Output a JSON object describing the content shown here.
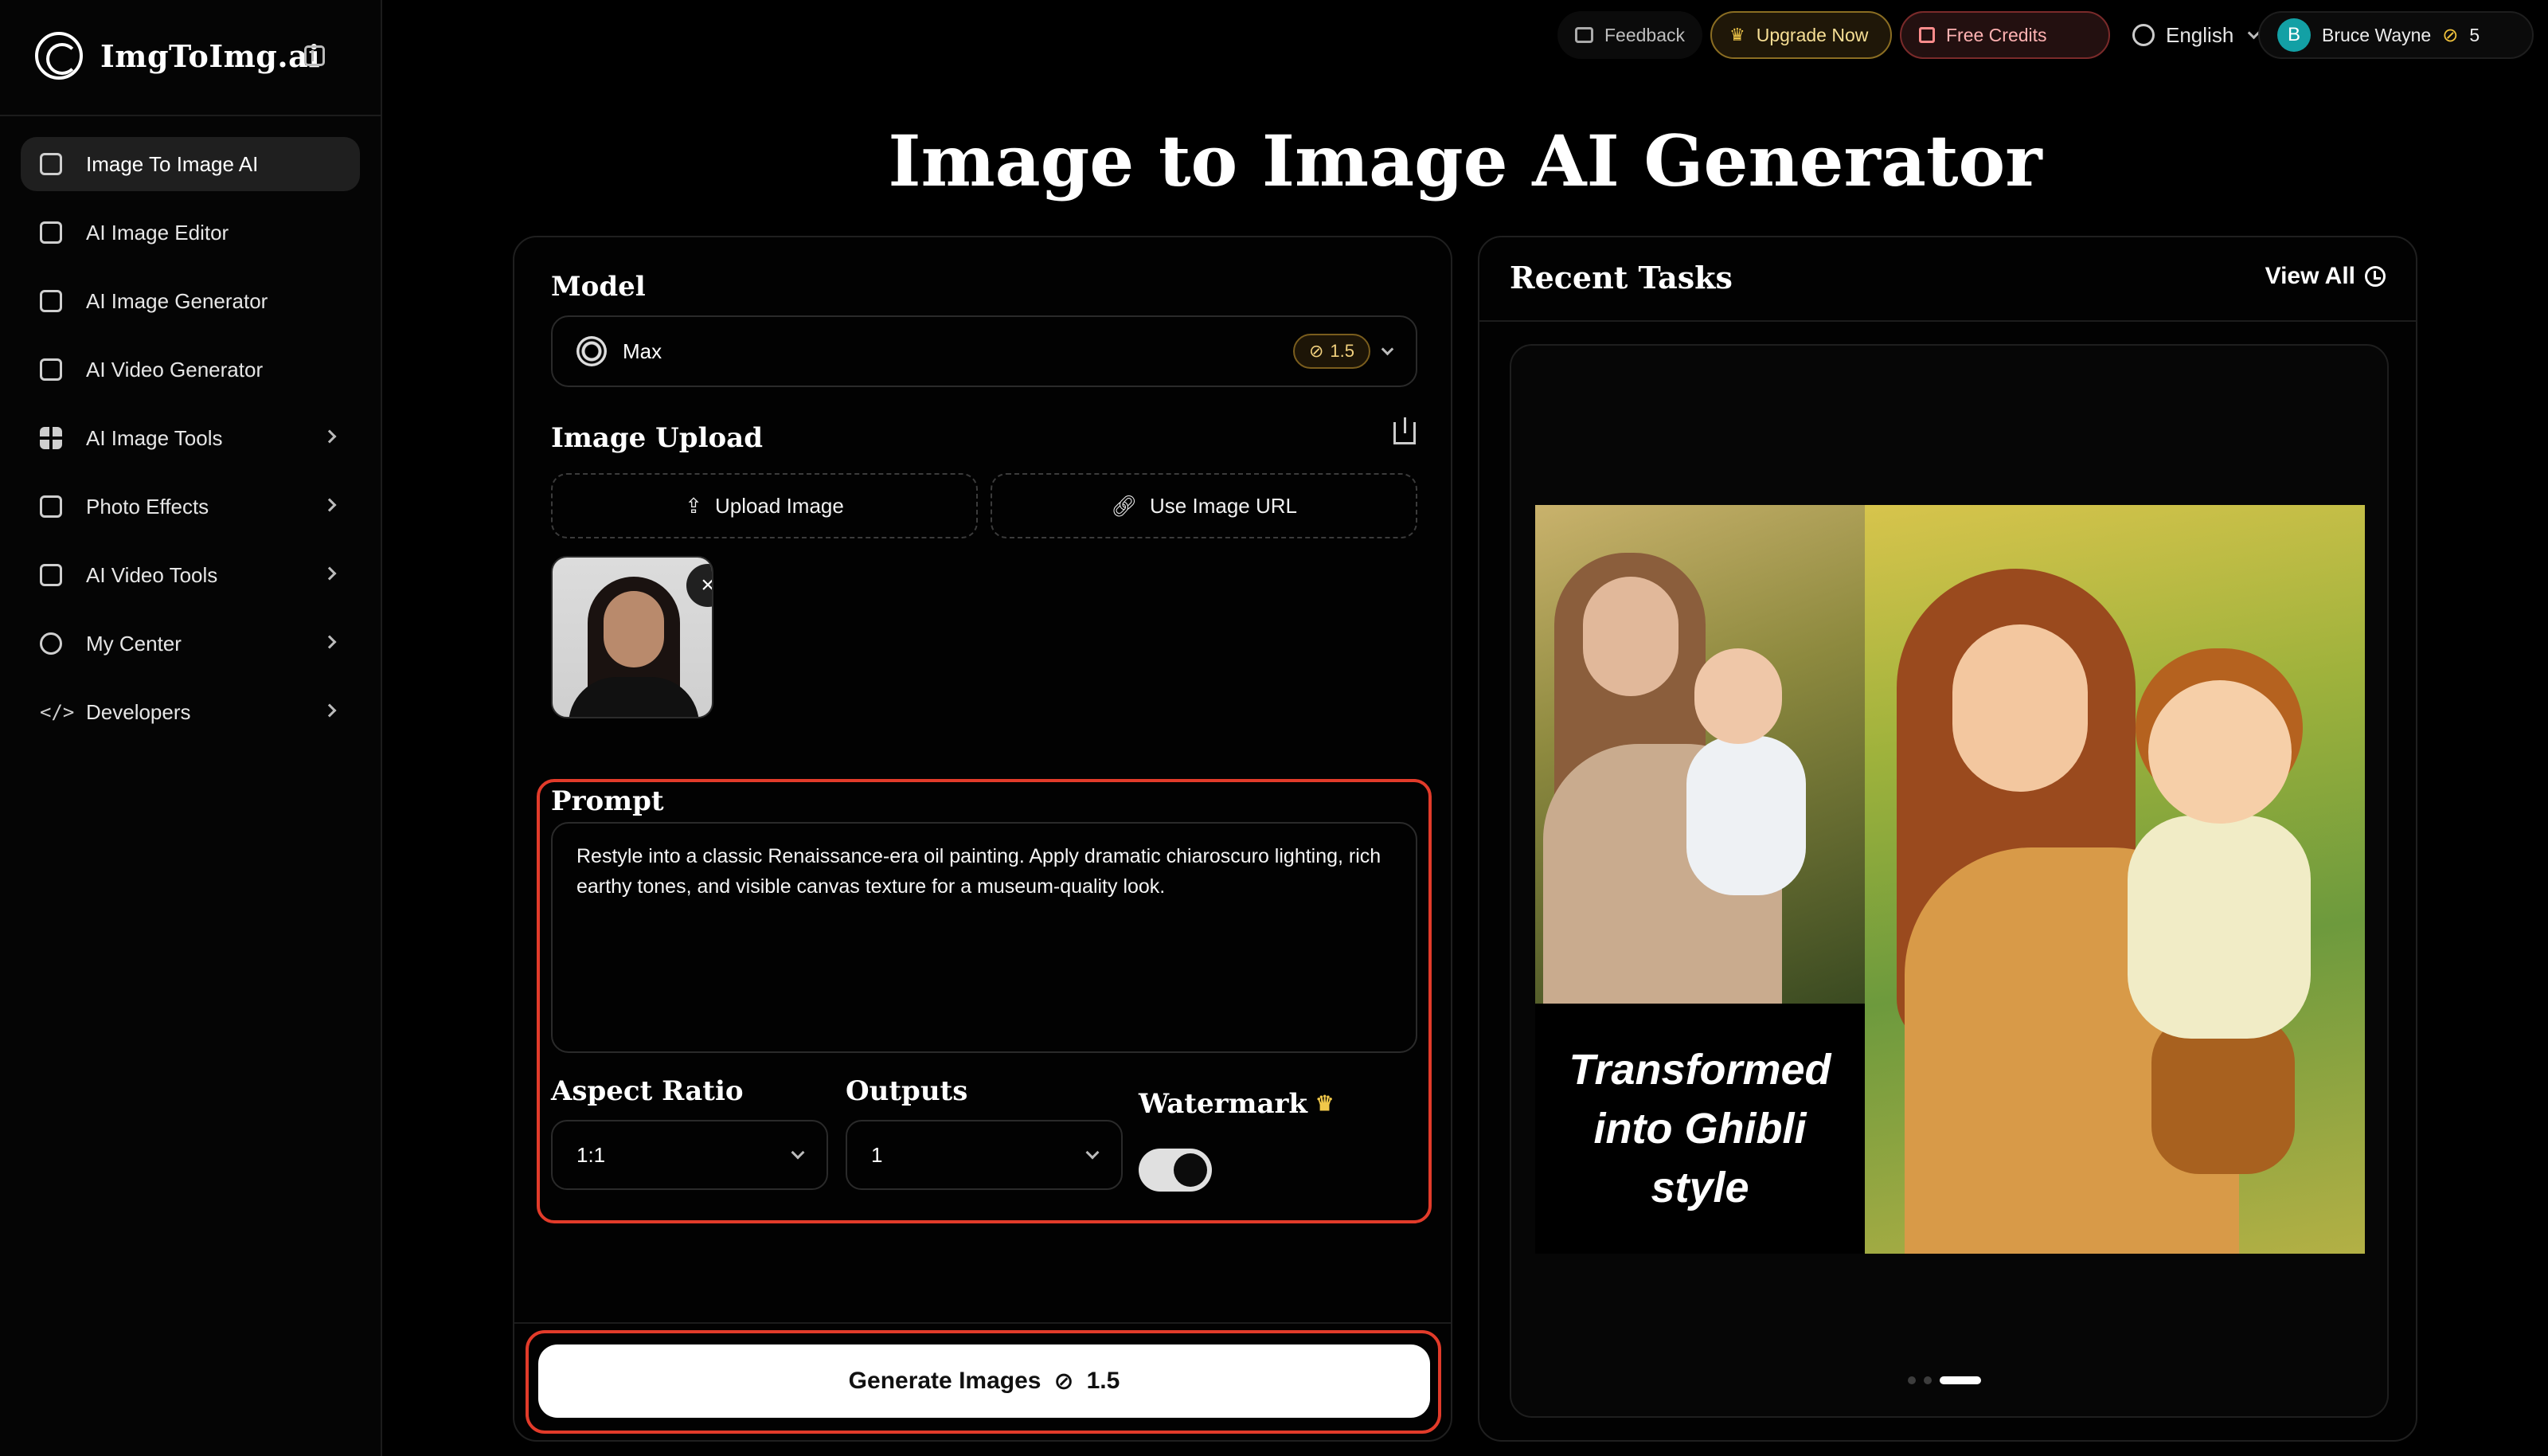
{
  "app": {
    "logo_text": "ImgToImg.ai"
  },
  "sidebar": {
    "items": [
      {
        "label": "Image To Image AI",
        "icon": "image-icon",
        "active": true,
        "has_chevron": false
      },
      {
        "label": "AI Image Editor",
        "icon": "edit-icon",
        "active": false,
        "has_chevron": false
      },
      {
        "label": "AI Image Generator",
        "icon": "sparkles-icon",
        "active": false,
        "has_chevron": false
      },
      {
        "label": "AI Video Generator",
        "icon": "clapperboard-icon",
        "active": false,
        "has_chevron": false
      },
      {
        "label": "AI Image Tools",
        "icon": "grid-icon",
        "active": false,
        "has_chevron": true
      },
      {
        "label": "Photo Effects",
        "icon": "brush-icon",
        "active": false,
        "has_chevron": true
      },
      {
        "label": "AI Video Tools",
        "icon": "film-icon",
        "active": false,
        "has_chevron": true
      },
      {
        "label": "My Center",
        "icon": "user-circle-icon",
        "active": false,
        "has_chevron": true
      },
      {
        "label": "Developers",
        "icon": "code-icon",
        "active": false,
        "has_chevron": true
      }
    ]
  },
  "topbar": {
    "feedback": "Feedback",
    "upgrade": "Upgrade Now",
    "free_credits": "Free Credits",
    "language": "English",
    "user_initial": "B",
    "user_name": "Bruce Wayne",
    "credits": "5"
  },
  "main": {
    "title": "Image to Image AI Generator",
    "model_label": "Model",
    "model_value": "Max",
    "model_cost": "1.5",
    "upload_label": "Image Upload",
    "upload_button": "Upload Image",
    "url_button": "Use Image URL",
    "prompt_label": "Prompt",
    "prompt_value": "Restyle into a classic Renaissance-era oil painting. Apply dramatic chiaroscuro lighting, rich earthy tones, and visible canvas texture for a museum-quality look.",
    "aspect_label": "Aspect Ratio",
    "aspect_value": "1:1",
    "outputs_label": "Outputs",
    "outputs_value": "1",
    "watermark_label": "Watermark",
    "watermark_on": true,
    "generate_label": "Generate Images",
    "generate_cost": "1.5"
  },
  "recent": {
    "title": "Recent Tasks",
    "view_all": "View All",
    "caption": "Transformed into Ghibli style",
    "slide_count": 3,
    "active_slide": 3
  },
  "colors": {
    "accent_gold": "#f1c84a",
    "highlight_red": "#e23b2a",
    "avatar_teal": "#13a0a5"
  }
}
